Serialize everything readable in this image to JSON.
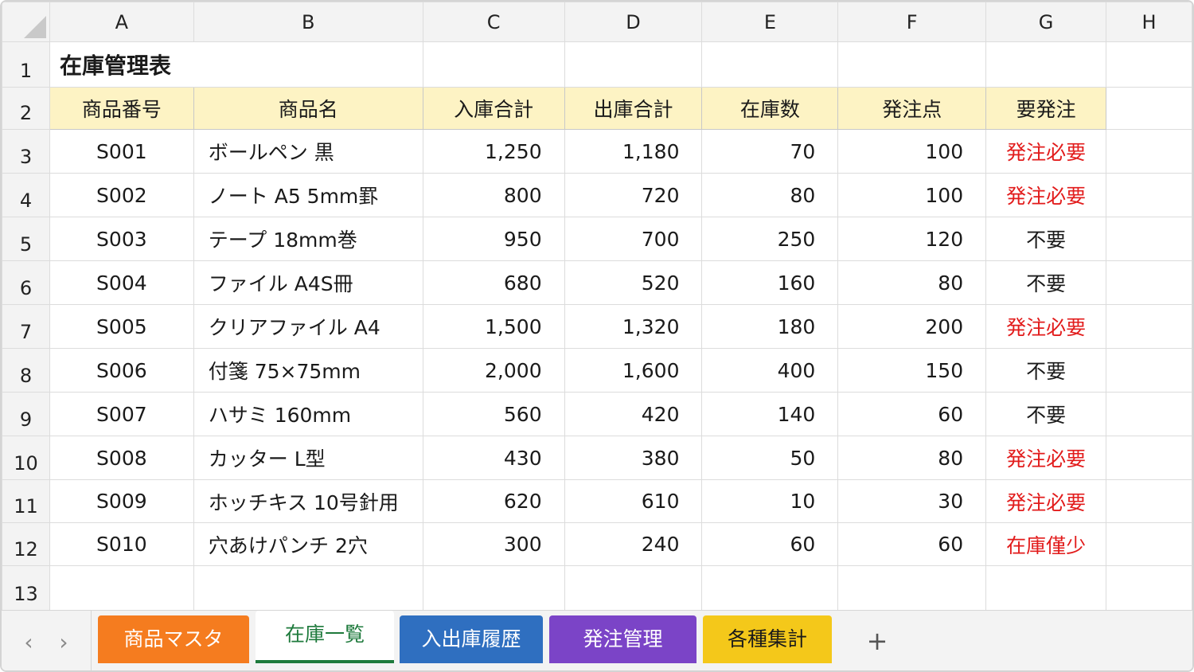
{
  "columns": [
    "A",
    "B",
    "C",
    "D",
    "E",
    "F",
    "G",
    "H"
  ],
  "title": "在庫管理表",
  "headers": [
    "商品番号",
    "商品名",
    "入庫合計",
    "出庫合計",
    "在庫数",
    "発注点",
    "要発注"
  ],
  "rows": [
    [
      "S001",
      "ボールペン 黒",
      "1,250",
      "1,180",
      "70",
      "100",
      "発注必要"
    ],
    [
      "S002",
      "ノート A5 5mm罫",
      "800",
      "720",
      "80",
      "100",
      "発注必要"
    ],
    [
      "S003",
      "テープ 18mm巻",
      "950",
      "700",
      "250",
      "120",
      "不要"
    ],
    [
      "S004",
      "ファイル A4S冊",
      "680",
      "520",
      "160",
      "80",
      "不要"
    ],
    [
      "S005",
      "クリアファイル A4",
      "1,500",
      "1,320",
      "180",
      "200",
      "発注必要"
    ],
    [
      "S006",
      "付箋 75×75mm",
      "2,000",
      "1,600",
      "400",
      "150",
      "不要"
    ],
    [
      "S007",
      "ハサミ 160mm",
      "560",
      "420",
      "140",
      "60",
      "不要"
    ],
    [
      "S008",
      "カッター L型",
      "430",
      "380",
      "50",
      "80",
      "発注必要"
    ],
    [
      "S009",
      "ホッチキス 10号針用",
      "620",
      "610",
      "10",
      "30",
      "発注必要"
    ],
    [
      "S010",
      "穴あけパンチ 2穴",
      "300",
      "240",
      "60",
      "60",
      "在庫僅少"
    ]
  ],
  "row_numbers": [
    "1",
    "2",
    "3",
    "4",
    "5",
    "6",
    "7",
    "8",
    "9",
    "10",
    "11",
    "12",
    "13"
  ],
  "alert_values": [
    "発注必要",
    "在庫僅少"
  ],
  "tabs": [
    {
      "label": "商品マスタ",
      "color": "#f57c1f",
      "active": false
    },
    {
      "label": "在庫一覧",
      "color": "#ffffff",
      "active": true
    },
    {
      "label": "入出庫履歴",
      "color": "#2f6fc0",
      "active": false
    },
    {
      "label": "発注管理",
      "color": "#7b44c7",
      "active": false
    },
    {
      "label": "各種集計",
      "color": "#f4c81a",
      "active": false
    }
  ],
  "nav": {
    "prev": "‹",
    "next": "›",
    "add": "+"
  },
  "colors": {
    "header_fill": "#fdf3c4",
    "alert_text": "#e21b1b",
    "active_tab": "#1e7a3c"
  }
}
